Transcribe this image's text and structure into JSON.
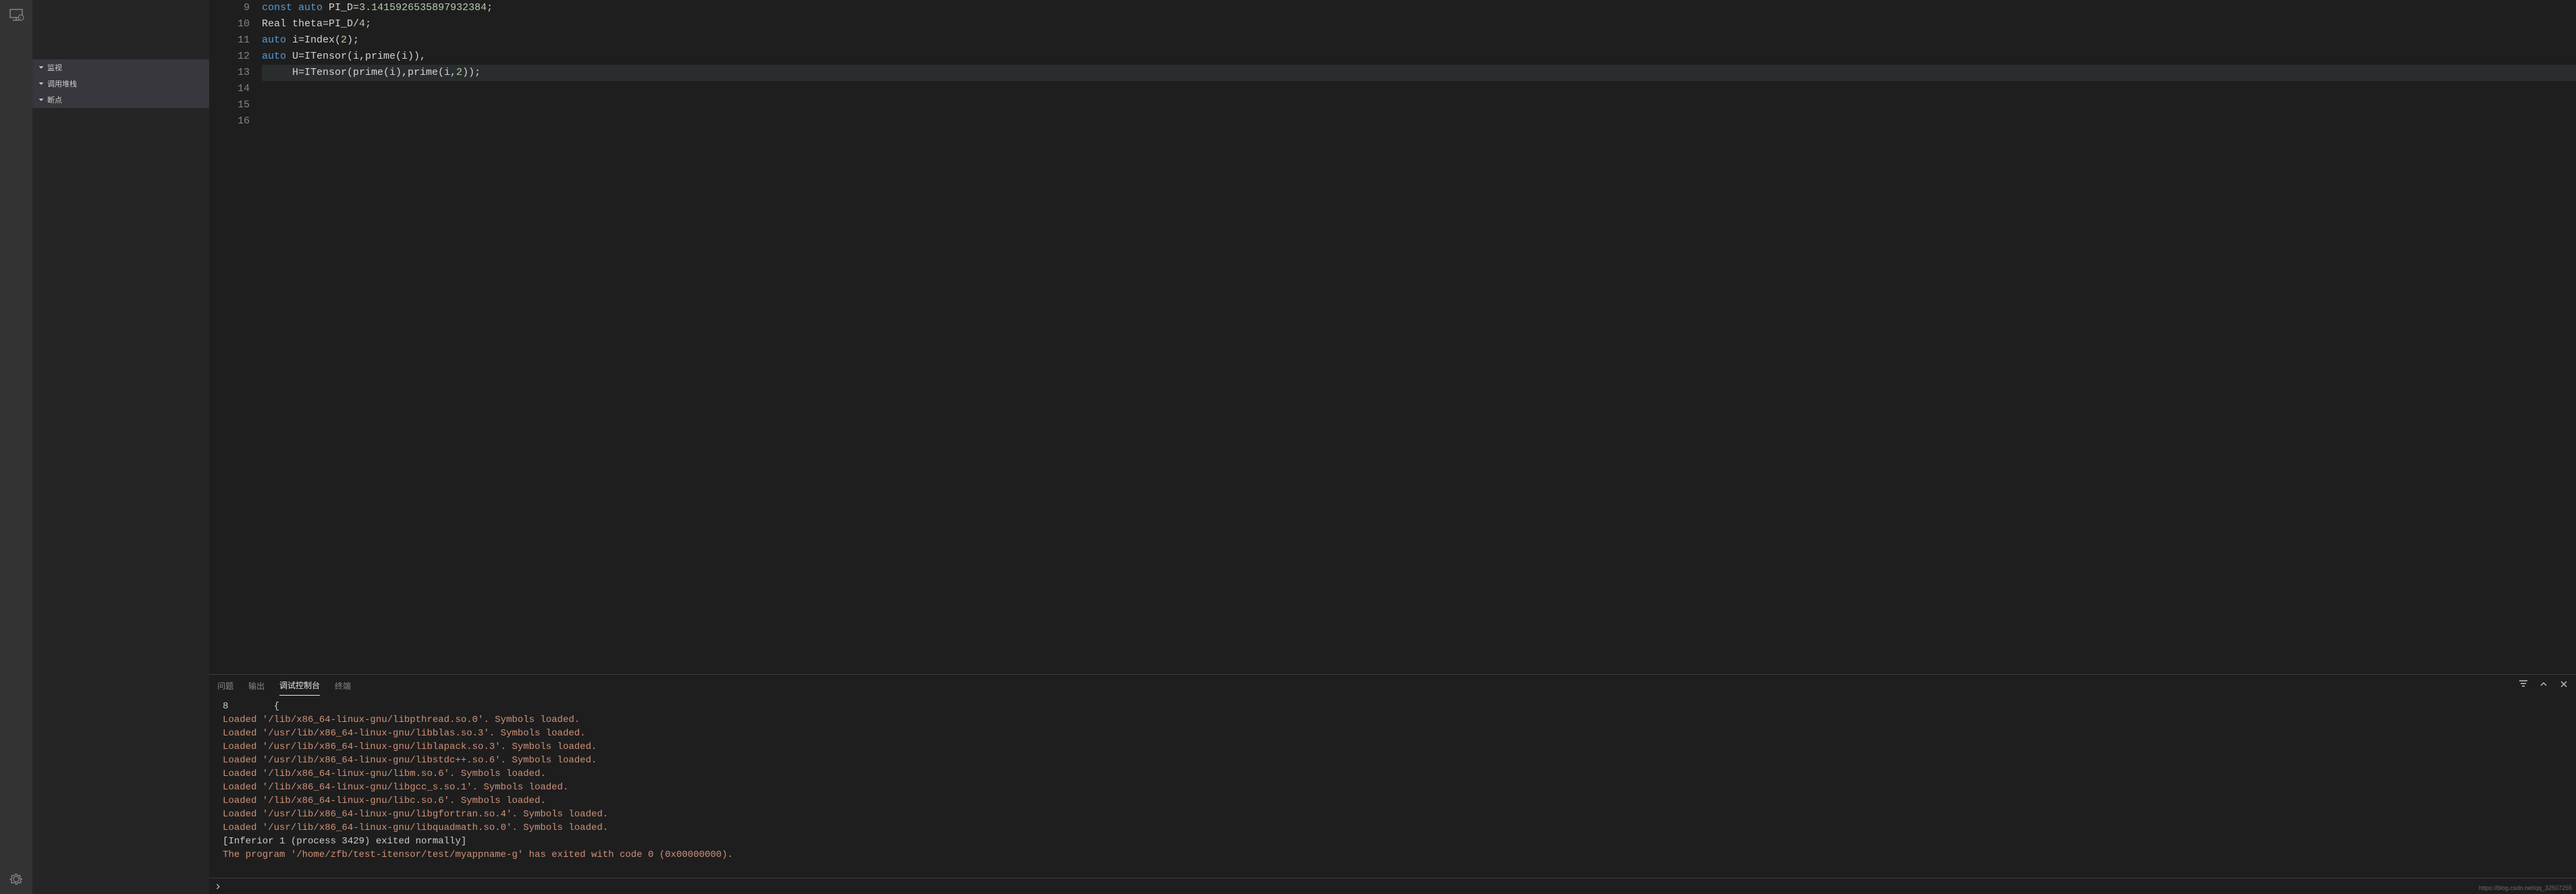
{
  "activity": {
    "remote_icon": "remote-icon",
    "settings_icon": "gear-icon"
  },
  "sidebar": {
    "sections": [
      {
        "id": "watch",
        "label": "监视"
      },
      {
        "id": "callstack",
        "label": "调用堆栈"
      },
      {
        "id": "breakpoints",
        "label": "断点"
      }
    ]
  },
  "editor": {
    "lines": [
      {
        "num": "9",
        "tokens": [
          [
            "kw",
            "const"
          ],
          [
            "id",
            " "
          ],
          [
            "kw",
            "auto"
          ],
          [
            "id",
            " PI_D="
          ],
          [
            "num",
            "3.1415926535897932384"
          ],
          [
            "id",
            ";"
          ]
        ]
      },
      {
        "num": "10",
        "tokens": [
          [
            "ty",
            "Real"
          ],
          [
            "id",
            " theta=PI_D/"
          ],
          [
            "num",
            "4"
          ],
          [
            "id",
            ";"
          ]
        ]
      },
      {
        "num": "11",
        "tokens": [
          [
            "id",
            ""
          ]
        ]
      },
      {
        "num": "12",
        "tokens": [
          [
            "kw",
            "auto"
          ],
          [
            "id",
            " i=Index("
          ],
          [
            "num",
            "2"
          ],
          [
            "id",
            ");"
          ]
        ]
      },
      {
        "num": "13",
        "tokens": [
          [
            "id",
            ""
          ]
        ]
      },
      {
        "num": "14",
        "tokens": [
          [
            "kw",
            "auto"
          ],
          [
            "id",
            " U=ITensor(i,prime(i)),"
          ]
        ]
      },
      {
        "num": "15",
        "tokens": [
          [
            "id",
            "     H=ITensor(prime(i),prime(i,"
          ],
          [
            "num",
            "2"
          ],
          [
            "id",
            "));"
          ]
        ],
        "highlight": true
      },
      {
        "num": "16",
        "tokens": [
          [
            "id",
            ""
          ]
        ]
      }
    ]
  },
  "panel": {
    "tabs": [
      {
        "id": "problems",
        "label": "问题"
      },
      {
        "id": "output",
        "label": "输出"
      },
      {
        "id": "debug",
        "label": "调试控制台",
        "active": true
      },
      {
        "id": "terminal",
        "label": "终端"
      }
    ],
    "output": [
      {
        "cls": "out-white",
        "text": "8        {"
      },
      {
        "cls": "out-yellow",
        "text": "Loaded '/lib/x86_64-linux-gnu/libpthread.so.0'. Symbols loaded."
      },
      {
        "cls": "out-yellow",
        "text": "Loaded '/usr/lib/x86_64-linux-gnu/libblas.so.3'. Symbols loaded."
      },
      {
        "cls": "out-yellow",
        "text": "Loaded '/usr/lib/x86_64-linux-gnu/liblapack.so.3'. Symbols loaded."
      },
      {
        "cls": "out-yellow",
        "text": "Loaded '/usr/lib/x86_64-linux-gnu/libstdc++.so.6'. Symbols loaded."
      },
      {
        "cls": "out-yellow",
        "text": "Loaded '/lib/x86_64-linux-gnu/libm.so.6'. Symbols loaded."
      },
      {
        "cls": "out-yellow",
        "text": "Loaded '/lib/x86_64-linux-gnu/libgcc_s.so.1'. Symbols loaded."
      },
      {
        "cls": "out-yellow",
        "text": "Loaded '/lib/x86_64-linux-gnu/libc.so.6'. Symbols loaded."
      },
      {
        "cls": "out-yellow",
        "text": "Loaded '/usr/lib/x86_64-linux-gnu/libgfortran.so.4'. Symbols loaded."
      },
      {
        "cls": "out-yellow",
        "text": "Loaded '/usr/lib/x86_64-linux-gnu/libquadmath.so.0'. Symbols loaded."
      },
      {
        "cls": "out-white",
        "text": "[Inferior 1 (process 3429) exited normally]"
      },
      {
        "cls": "out-yellow",
        "text": "The program '/home/zfb/test-itensor/test/myappname-g' has exited with code 0 (0x00000000)."
      }
    ]
  },
  "watermark": "https://blog.csdn.net/qq_32507255"
}
